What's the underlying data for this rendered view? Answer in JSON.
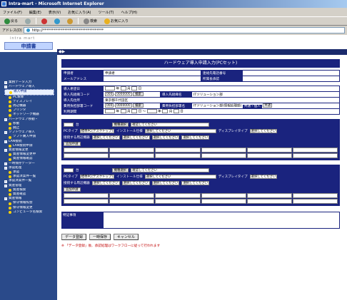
{
  "window": {
    "title": "Intra-mart - Microsoft Internet Explorer"
  },
  "menu": [
    "ファイル(F)",
    "編集(E)",
    "表示(V)",
    "お気に入り(A)",
    "ツール(T)",
    "ヘルプ(H)"
  ],
  "toolbar": {
    "back": "戻る",
    "search": "検索",
    "favorites": "お気に入り"
  },
  "address": {
    "label": "アドレス(D)",
    "value": "http://**********************************"
  },
  "logo": {
    "brand": "intra mart",
    "tab": "申請書"
  },
  "header_strip": "◆▶",
  "sidebar": {
    "items": [
      {
        "label": "業務データ入力",
        "icon": "sq"
      },
      {
        "label": "ハードウェア導入",
        "icon": "sq"
      },
      {
        "label": "導入申請",
        "icon": "dot",
        "active": true
      },
      {
        "label": "PC本体",
        "icon": "dot"
      },
      {
        "label": "ディスプレイ",
        "icon": "dot"
      },
      {
        "label": "周辺機器",
        "icon": "dot"
      },
      {
        "label": "プリンタ",
        "icon": "dot"
      },
      {
        "label": "ネットワーク機器",
        "icon": "dot"
      },
      {
        "label": "ハードウェア移動・",
        "icon": "sq"
      },
      {
        "label": "移動",
        "icon": "dot"
      },
      {
        "label": "廃止",
        "icon": "dot"
      },
      {
        "label": "ソフトウェア導入",
        "icon": "sq"
      },
      {
        "label": "ソフト購入申請",
        "icon": "dot"
      },
      {
        "label": "LAN接続",
        "icon": "sq"
      },
      {
        "label": "LAN接続申請",
        "icon": "dot"
      },
      {
        "label": "資産情報変更",
        "icon": "sq"
      },
      {
        "label": "資産情報変更申",
        "icon": "dot"
      },
      {
        "label": "資産情報確認",
        "icon": "dot"
      },
      {
        "label": "一時保存データ一",
        "icon": "sq"
      },
      {
        "label": "承認処理",
        "icon": "sq"
      },
      {
        "label": "承認",
        "icon": "dot"
      },
      {
        "label": "承認済案件一覧",
        "icon": "dot"
      },
      {
        "label": "承認済案件一覧",
        "icon": "sq"
      },
      {
        "label": "資産管理",
        "icon": "sq"
      },
      {
        "label": "資産検索",
        "icon": "dot"
      },
      {
        "label": "資産確認",
        "icon": "dot"
      },
      {
        "label": "資産情報",
        "icon": "sq"
      },
      {
        "label": "保守情報照会",
        "icon": "dot"
      },
      {
        "label": "保守情報変更",
        "icon": "dot"
      },
      {
        "label": "コンピュータ名検索",
        "icon": "dot"
      }
    ]
  },
  "form": {
    "title": "ハードウェア導入申請入力(PCセット)",
    "applicant_label": "申請者",
    "applicant_value": "申請者",
    "phone_label": "連絡先電話番号",
    "mail_label": "メールアドレス",
    "approver_label": "所属長承認",
    "wish_date_label": "導入希望日",
    "year": "年",
    "month": "月",
    "day": "日",
    "org_code_label": "導入先組織コード",
    "org_code_prefix": "000",
    "org_code_value": "0000000",
    "search_btn": "検索",
    "org_name_label": "導入先組織名",
    "org_name_value": "ITソリューション部",
    "dest_label": "導入先住所",
    "dest_value": "東京都千代田区",
    "cost_code_label": "費用負担部署コード",
    "cost_code_value": "0000000",
    "cost_name_label": "費用負担部署名",
    "cost_name_value": "ITソリューション部(情報処理部)",
    "share_label": "共通・個人",
    "share_value": "共通",
    "period_label": "利用期間",
    "period_sep": "〜"
  },
  "pc_blocks": [
    {
      "count_suffix": "台",
      "model_btn": "機種選択",
      "model_placeholder": "確認してください",
      "type_label": "PCタイプ",
      "type_value": "標準PC(デスクトップ)",
      "install_label": "インストール仕様",
      "install_value": "選択してください",
      "display_label": "ディスプレイタイプ",
      "display_value": "選択してください",
      "periph_label": "接続する周辺機器",
      "periph_values": [
        "選択してください",
        "選択してください",
        "選択してください",
        "選択してください"
      ],
      "add_btn": "追加申請"
    },
    {
      "count_suffix": "台",
      "model_btn": "機種選択",
      "model_placeholder": "確認してください",
      "type_label": "PCタイプ",
      "type_value": "標準PC(デスクトップ)",
      "install_label": "インストール仕様",
      "install_value": "選択してください",
      "display_label": "ディスプレイタイプ",
      "display_value": "選択してください",
      "periph_label": "接続する周辺機器",
      "periph_values": [
        "選択してください",
        "選択してください",
        "選択してください",
        "選択してください"
      ],
      "add_btn": "追加申請"
    }
  ],
  "note": {
    "label": "特記事項"
  },
  "actions": {
    "submit": "データ登録",
    "save": "一時保存",
    "cancel": "キャンセル"
  },
  "footnote": "※ 「データ登録」後、承認処理はワークフローに従って行われます"
}
